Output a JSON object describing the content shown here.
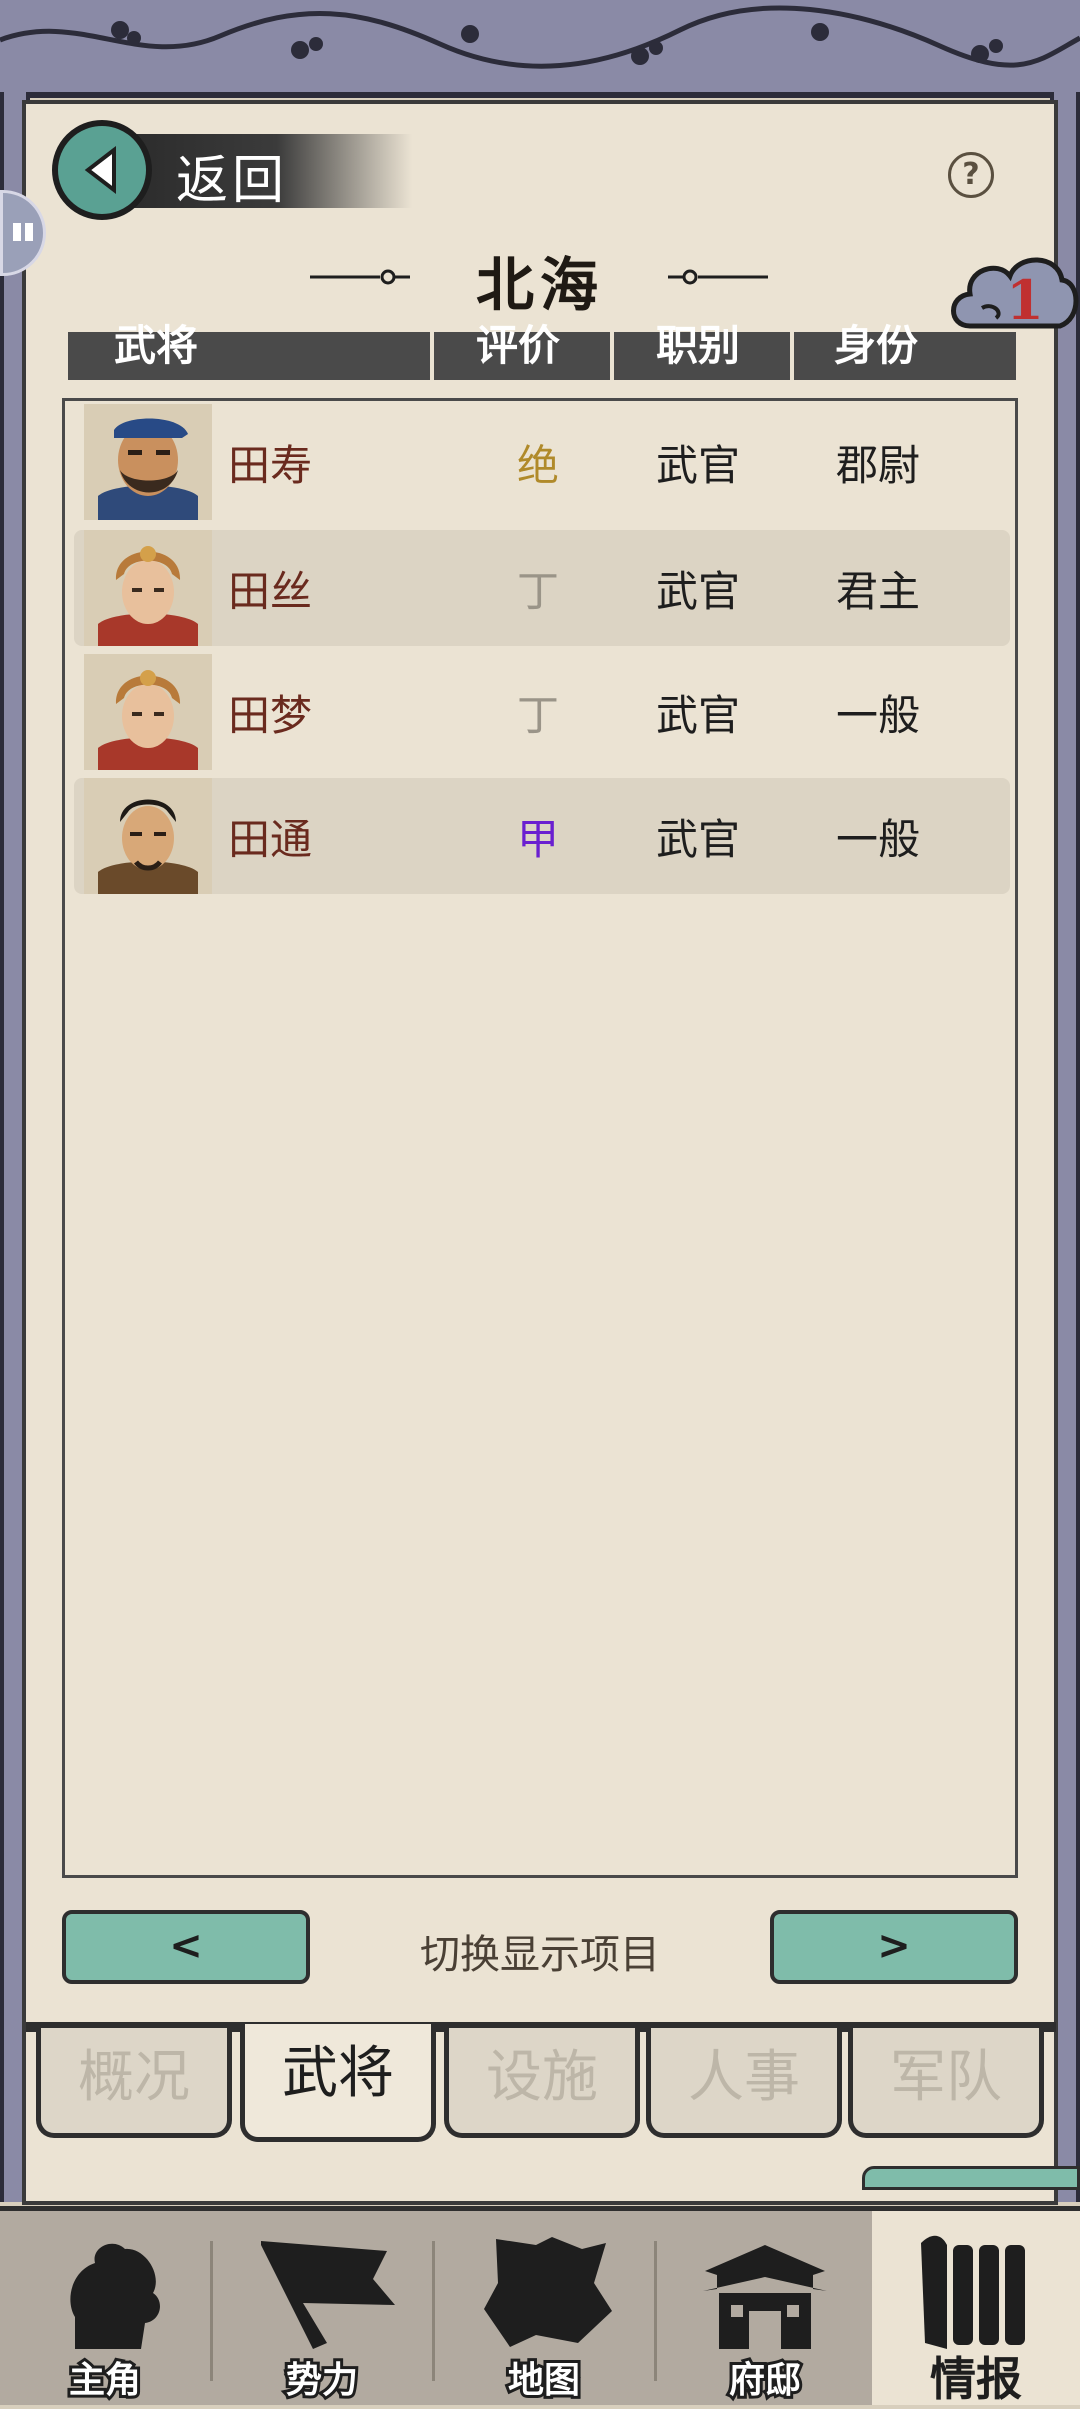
{
  "header": {
    "back_label": "返回",
    "help_label": "?",
    "city_name": "北海",
    "badge_count": "1"
  },
  "table": {
    "columns": [
      "武将",
      "评价",
      "职别",
      "身份"
    ],
    "rows": [
      {
        "name": "田寿",
        "rank": "绝",
        "rank_color": "#b08a2a",
        "role": "武官",
        "status": "郡尉",
        "portrait": "bearded-general-portrait"
      },
      {
        "name": "田丝",
        "rank": "丁",
        "rank_color": "#9a9488",
        "role": "武官",
        "status": "君主",
        "portrait": "helmeted-woman-portrait"
      },
      {
        "name": "田梦",
        "rank": "丁",
        "rank_color": "#9a9488",
        "role": "武官",
        "status": "一般",
        "portrait": "helmeted-woman-portrait"
      },
      {
        "name": "田通",
        "rank": "甲",
        "rank_color": "#6a1fd0",
        "role": "武官",
        "status": "一般",
        "portrait": "young-officer-portrait"
      }
    ]
  },
  "switcher": {
    "prev_label": "<",
    "next_label": ">",
    "label": "切换显示项目"
  },
  "sub_tabs": [
    {
      "label": "概况",
      "active": false
    },
    {
      "label": "武将",
      "active": true
    },
    {
      "label": "设施",
      "active": false
    },
    {
      "label": "人事",
      "active": false
    },
    {
      "label": "军队",
      "active": false
    }
  ],
  "bottom_nav": [
    {
      "label": "主角",
      "icon": "warrior-icon",
      "active": false
    },
    {
      "label": "势力",
      "icon": "flag-icon",
      "active": false
    },
    {
      "label": "地图",
      "icon": "map-icon",
      "active": false
    },
    {
      "label": "府邸",
      "icon": "mansion-icon",
      "active": false
    },
    {
      "label": "情报",
      "icon": "scroll-icon",
      "active": true
    }
  ],
  "colors": {
    "accent_teal": "#7fbcaa",
    "paper": "#ebe3d3",
    "frame": "#8a8aa6"
  }
}
